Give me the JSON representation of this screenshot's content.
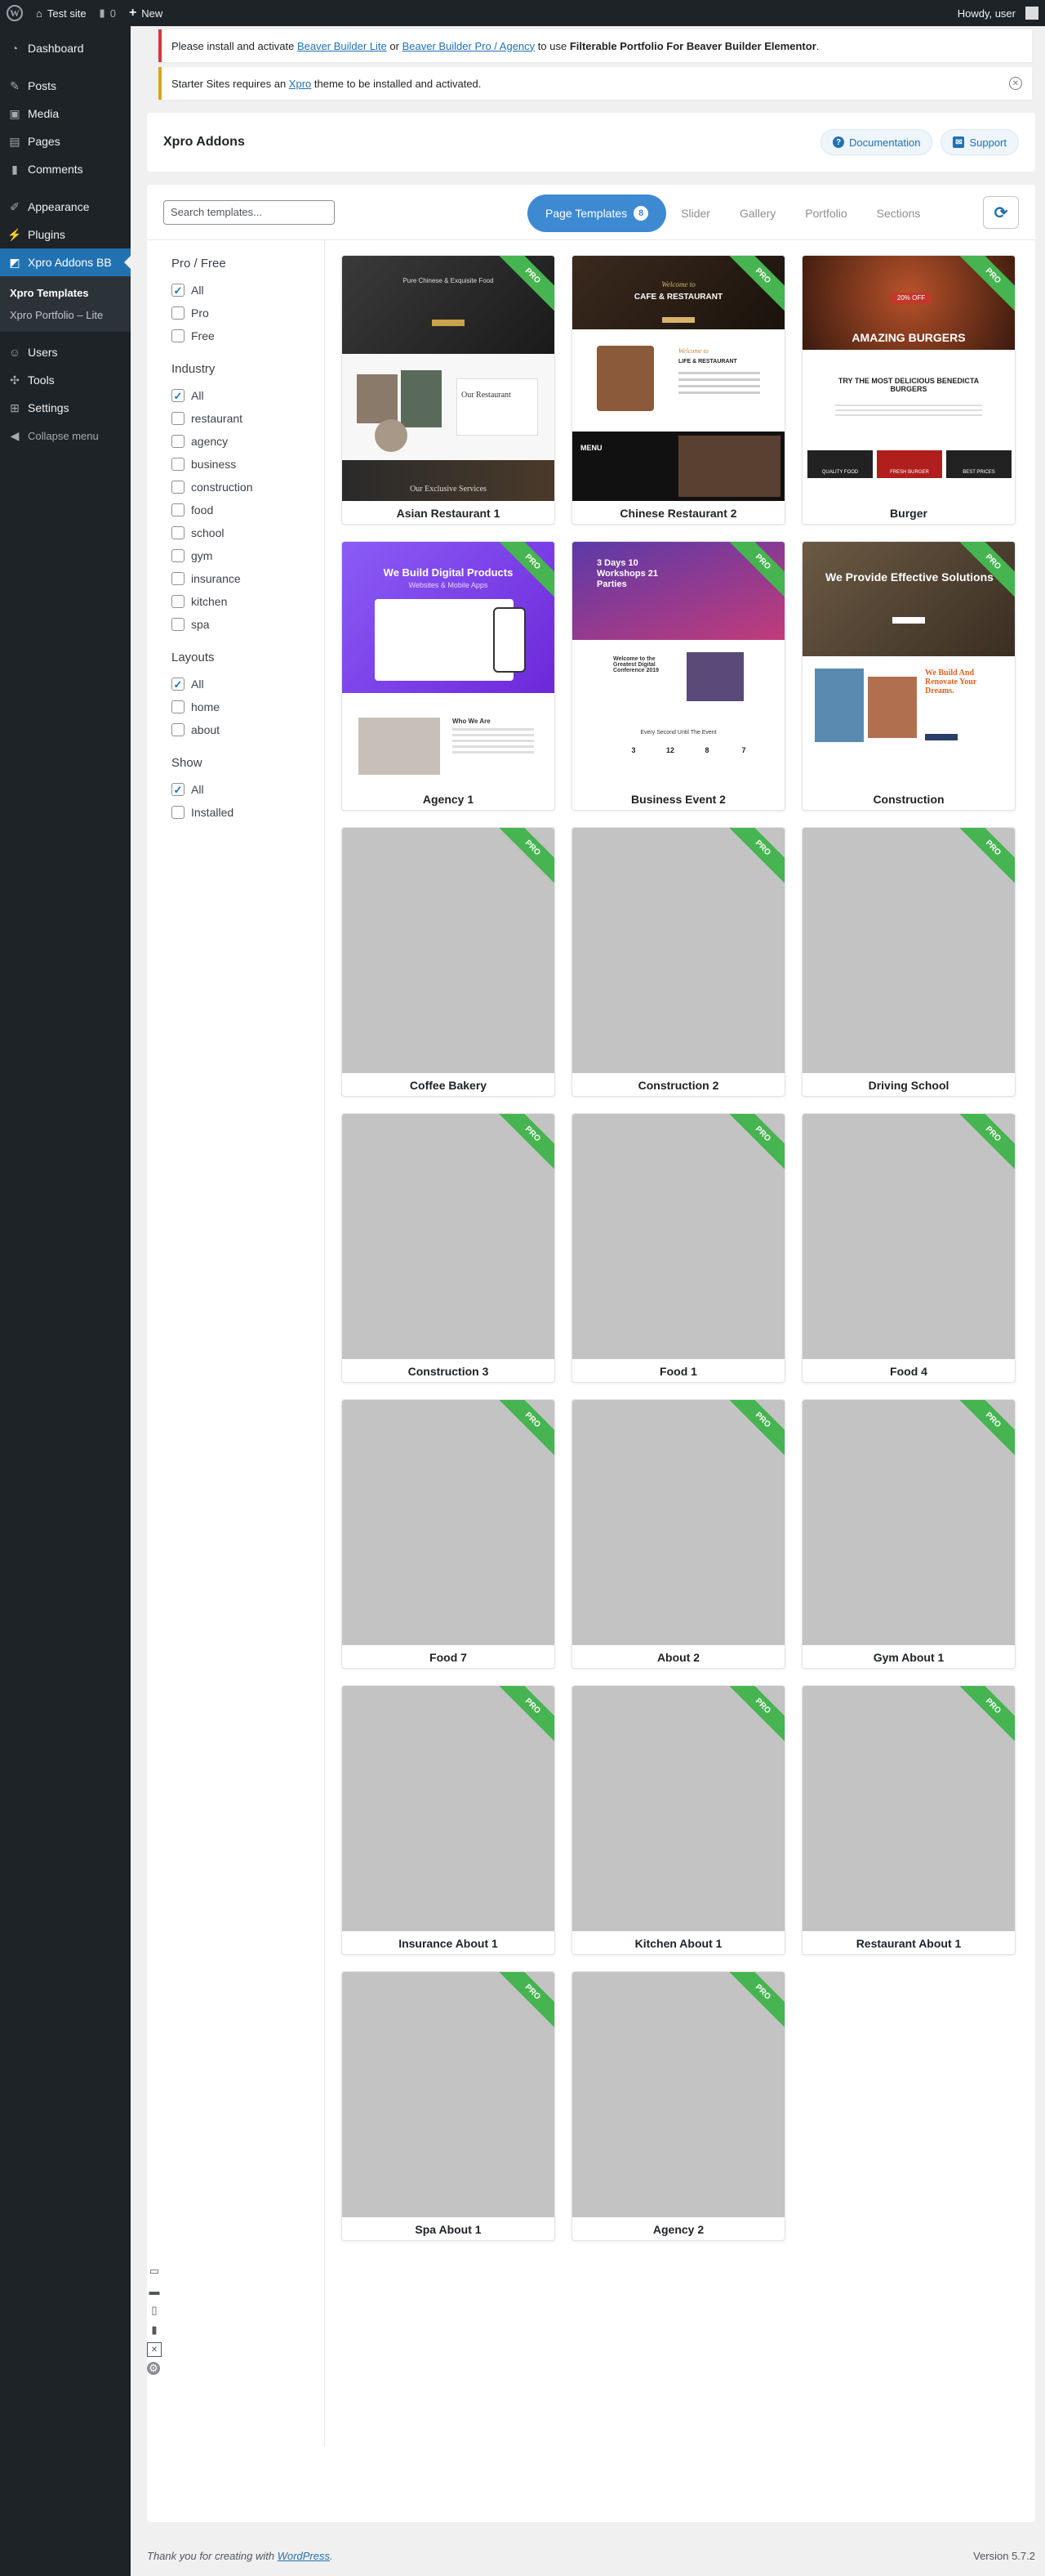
{
  "adminbar": {
    "site_name": "Test site",
    "comments_count": "0",
    "new_label": "New",
    "howdy": "Howdy, user"
  },
  "sidebar": {
    "items": [
      {
        "label": "Dashboard",
        "icon": "dashboard-icon"
      },
      {
        "label": "Posts",
        "icon": "pin-icon"
      },
      {
        "label": "Media",
        "icon": "media-icon"
      },
      {
        "label": "Pages",
        "icon": "pages-icon"
      },
      {
        "label": "Comments",
        "icon": "comments-icon"
      },
      {
        "label": "Appearance",
        "icon": "brush-icon"
      },
      {
        "label": "Plugins",
        "icon": "plug-icon"
      },
      {
        "label": "Xpro Addons BB",
        "icon": "xpro-icon"
      },
      {
        "label": "Users",
        "icon": "users-icon"
      },
      {
        "label": "Tools",
        "icon": "wrench-icon"
      },
      {
        "label": "Settings",
        "icon": "settings-icon"
      }
    ],
    "submenu": [
      "Xpro Templates",
      "Xpro Portfolio – Lite"
    ],
    "collapse_label": "Collapse menu"
  },
  "notices": {
    "first": {
      "prefix": "Please install and activate ",
      "link1": "Beaver Builder Lite",
      "mid": " or ",
      "link2": "Beaver Builder Pro / Agency",
      "suffix": " to use ",
      "bold": "Filterable Portfolio For Beaver Builder Elementor",
      "end": "."
    },
    "second": {
      "prefix": "Starter Sites requires an ",
      "link": "Xpro",
      "suffix": " theme to be installed and activated."
    }
  },
  "header": {
    "title": "Xpro Addons",
    "documentation": "Documentation",
    "support": "Support"
  },
  "toolbar": {
    "search_placeholder": "Search templates...",
    "tabs": [
      {
        "label": "Page Templates",
        "count": "8"
      },
      {
        "label": "Slider"
      },
      {
        "label": "Gallery"
      },
      {
        "label": "Portfolio"
      },
      {
        "label": "Sections"
      }
    ]
  },
  "filters": {
    "pro_free": {
      "title": "Pro / Free",
      "options": [
        {
          "label": "All",
          "checked": true
        },
        {
          "label": "Pro",
          "checked": false
        },
        {
          "label": "Free",
          "checked": false
        }
      ]
    },
    "industry": {
      "title": "Industry",
      "options": [
        {
          "label": "All",
          "checked": true
        },
        {
          "label": "restaurant",
          "checked": false
        },
        {
          "label": "agency",
          "checked": false
        },
        {
          "label": "business",
          "checked": false
        },
        {
          "label": "construction",
          "checked": false
        },
        {
          "label": "food",
          "checked": false
        },
        {
          "label": "school",
          "checked": false
        },
        {
          "label": "gym",
          "checked": false
        },
        {
          "label": "insurance",
          "checked": false
        },
        {
          "label": "kitchen",
          "checked": false
        },
        {
          "label": "spa",
          "checked": false
        }
      ]
    },
    "layouts": {
      "title": "Layouts",
      "options": [
        {
          "label": "All",
          "checked": true
        },
        {
          "label": "home",
          "checked": false
        },
        {
          "label": "about",
          "checked": false
        }
      ]
    },
    "show": {
      "title": "Show",
      "options": [
        {
          "label": "All",
          "checked": true
        },
        {
          "label": "Installed",
          "checked": false
        }
      ]
    }
  },
  "ribbon_label": "PRO",
  "templates": [
    {
      "title": "Asian Restaurant 1",
      "preview": "asian"
    },
    {
      "title": "Chinese Restaurant 2",
      "preview": "chinese"
    },
    {
      "title": "Burger",
      "preview": "burger"
    },
    {
      "title": "Agency 1",
      "preview": "agency"
    },
    {
      "title": "Business Event 2",
      "preview": "event"
    },
    {
      "title": "Construction",
      "preview": "construction"
    },
    {
      "title": "Coffee Bakery",
      "preview": ""
    },
    {
      "title": "Construction 2",
      "preview": ""
    },
    {
      "title": "Driving School",
      "preview": ""
    },
    {
      "title": "Construction 3",
      "preview": ""
    },
    {
      "title": "Food 1",
      "preview": ""
    },
    {
      "title": "Food 4",
      "preview": ""
    },
    {
      "title": "Food 7",
      "preview": ""
    },
    {
      "title": "About 2",
      "preview": ""
    },
    {
      "title": "Gym About 1",
      "preview": ""
    },
    {
      "title": "Insurance About 1",
      "preview": ""
    },
    {
      "title": "Kitchen About 1",
      "preview": ""
    },
    {
      "title": "Restaurant About 1",
      "preview": ""
    },
    {
      "title": "Spa About 1",
      "preview": ""
    },
    {
      "title": "Agency 2",
      "preview": ""
    }
  ],
  "previews": {
    "asian": {
      "tagline": "Pure Chinese & Exquisite Food",
      "heading": "Our Restaurant",
      "bottom": "Our Exclusive Services"
    },
    "chinese": {
      "heading": "CAFE & RESTAURANT",
      "welcome": "Welcome to",
      "sub": "LIFE & RESTAURANT",
      "menu": "MENU"
    },
    "burger": {
      "badge": "20% OFF",
      "heading": "AMAZING BURGERS",
      "sub": "TRY THE MOST DELICIOUS BENEDICTA BURGERS",
      "f1": "QUALITY FOOD",
      "f2": "FRESH BURGER",
      "f3": "BEST PRICES"
    },
    "agency": {
      "heading": "We Build Digital Products",
      "sub": "Websites & Mobile Apps",
      "who": "Who We Are"
    },
    "event": {
      "heading": "3 Days 10 Workshops 21 Parties",
      "welcome": "Welcome to the Greatest Digital Conference 2019",
      "every": "Every Second Until The Event",
      "n1": "3",
      "n2": "12",
      "n3": "8",
      "n4": "7"
    },
    "construction": {
      "heading": "We Provide Effective Solutions",
      "build": "We Build And Renovate Your Dreams."
    }
  },
  "footer": {
    "thanks": "Thank you for creating with ",
    "link": "WordPress",
    "end": ".",
    "version": "Version 5.7.2"
  },
  "colors": {
    "accent": "#2271b1",
    "ribbon": "#46b450",
    "tab_active": "#3d8ad3"
  }
}
